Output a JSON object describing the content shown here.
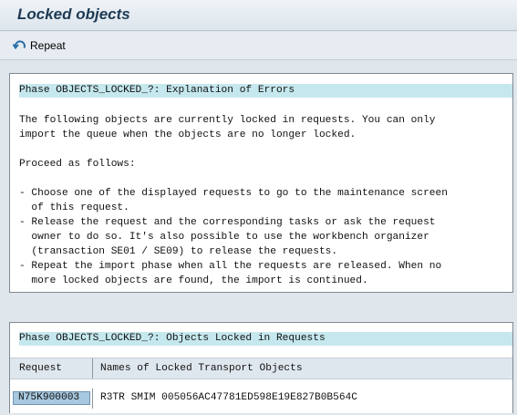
{
  "window": {
    "title": "Locked objects"
  },
  "toolbar": {
    "repeat_label": "Repeat",
    "repeat_icon": "repeat-icon"
  },
  "errors_panel": {
    "header": "Phase OBJECTS_LOCKED_?: Explanation of Errors",
    "lines": [
      "The following objects are currently locked in requests. You can only",
      "import the queue when the objects are no longer locked.",
      "",
      "Proceed as follows:",
      "",
      "- Choose one of the displayed requests to go to the maintenance screen",
      "  of this request.",
      "- Release the request and the corresponding tasks or ask the request",
      "  owner to do so. It's also possible to use the workbench organizer",
      "  (transaction SE01 / SE09) to release the requests.",
      "- Repeat the import phase when all the requests are released. When no",
      "  more locked objects are found, the import is continued."
    ]
  },
  "objects_panel": {
    "header": "Phase OBJECTS_LOCKED_?: Objects Locked in Requests",
    "columns": [
      "Request",
      "Names of Locked Transport Objects"
    ],
    "rows": [
      {
        "request": "N75K900003",
        "objects": "R3TR SMIM 005056AC47781ED598E19E827B0B564C"
      }
    ]
  }
}
